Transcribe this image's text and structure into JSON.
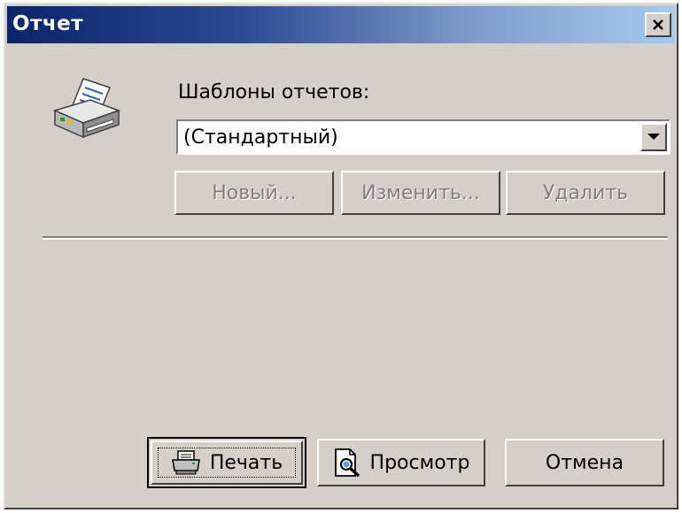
{
  "window": {
    "title": "Отчет",
    "close_symbol": "✕"
  },
  "report": {
    "templates_label": "Шаблоны отчетов:",
    "selected_template": "(Стандартный)",
    "icon": "printer-icon"
  },
  "template_buttons": {
    "new_label": "Новый...",
    "edit_label": "Изменить...",
    "delete_label": "Удалить"
  },
  "actions": {
    "print_label": "Печать",
    "print_icon": "printer-icon",
    "preview_label": "Просмотр",
    "preview_icon": "magnifier-document-icon",
    "cancel_label": "Отмена"
  },
  "colors": {
    "title_gradient_start": "#0a246a",
    "title_gradient_end": "#a6caf0",
    "face": "#d4d0c8",
    "disabled_text": "#808080"
  }
}
